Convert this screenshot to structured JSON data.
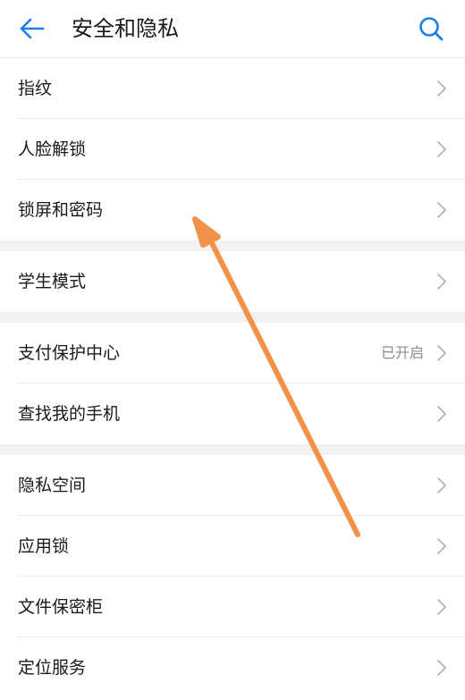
{
  "header": {
    "title": "安全和隐私",
    "back_icon": "arrow-left-icon",
    "search_icon": "search-icon",
    "accent_color": "#1a7fe8"
  },
  "groups": [
    {
      "items": [
        {
          "label": "指纹",
          "value": ""
        },
        {
          "label": "人脸解锁",
          "value": ""
        },
        {
          "label": "锁屏和密码",
          "value": ""
        }
      ]
    },
    {
      "items": [
        {
          "label": "学生模式",
          "value": ""
        }
      ]
    },
    {
      "items": [
        {
          "label": "支付保护中心",
          "value": "已开启"
        },
        {
          "label": "查找我的手机",
          "value": ""
        }
      ]
    },
    {
      "items": [
        {
          "label": "隐私空间",
          "value": ""
        },
        {
          "label": "应用锁",
          "value": ""
        },
        {
          "label": "文件保密柜",
          "value": ""
        },
        {
          "label": "定位服务",
          "value": ""
        }
      ]
    }
  ],
  "annotation": {
    "arrow_color": "#f0924a"
  }
}
